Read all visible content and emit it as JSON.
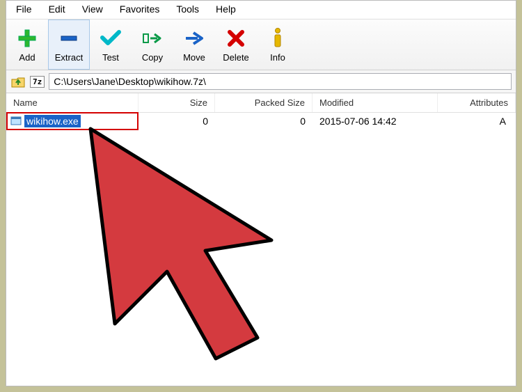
{
  "menu": {
    "file": "File",
    "edit": "Edit",
    "view": "View",
    "favorites": "Favorites",
    "tools": "Tools",
    "help": "Help"
  },
  "toolbar": {
    "add": "Add",
    "extract": "Extract",
    "test": "Test",
    "copy": "Copy",
    "move": "Move",
    "delete": "Delete",
    "info": "Info"
  },
  "address": {
    "sevenz_badge": "7z",
    "path": "C:\\Users\\Jane\\Desktop\\wikihow.7z\\"
  },
  "columns": {
    "name": "Name",
    "size": "Size",
    "packed_size": "Packed Size",
    "modified": "Modified",
    "attributes": "Attributes"
  },
  "rows": [
    {
      "name": "wikihow.exe",
      "size": "0",
      "packed_size": "0",
      "modified": "2015-07-06 14:42",
      "attributes": "A"
    }
  ]
}
